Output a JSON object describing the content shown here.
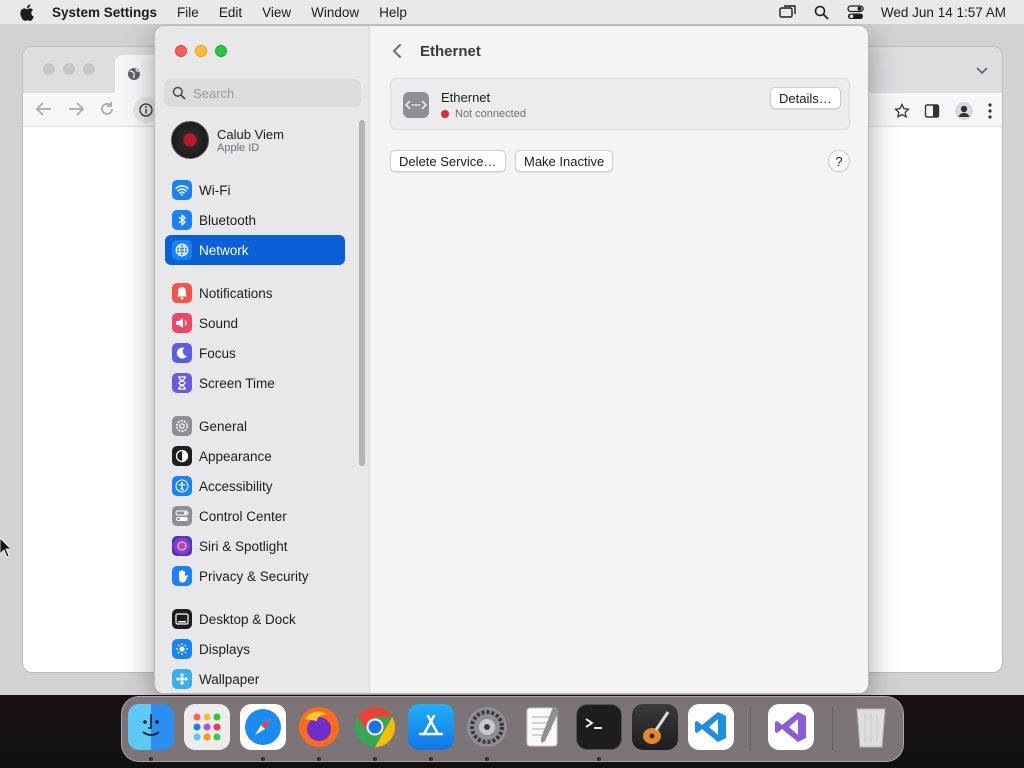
{
  "menubar": {
    "app_name": "System Settings",
    "menus": [
      "File",
      "Edit",
      "View",
      "Window",
      "Help"
    ],
    "clock": "Wed Jun 14  1:57 AM",
    "status_icons": [
      "screen-mirroring-icon",
      "spotlight-search-icon",
      "control-center-icon"
    ]
  },
  "sidebar": {
    "search_placeholder": "Search",
    "account": {
      "name": "Calub Viem",
      "subtitle": "Apple ID"
    },
    "items": [
      {
        "label": "Wi-Fi",
        "icon": "wifi-icon",
        "color": "#1a82f7"
      },
      {
        "label": "Bluetooth",
        "icon": "bluetooth-icon",
        "color": "#1a82f7"
      },
      {
        "label": "Network",
        "icon": "globe-icon",
        "color": "#1a82f7",
        "selected": true
      },
      {
        "label": "Notifications",
        "icon": "bell-icon",
        "color": "#f2534a"
      },
      {
        "label": "Sound",
        "icon": "speaker-icon",
        "color": "#f0466a"
      },
      {
        "label": "Focus",
        "icon": "moon-icon",
        "color": "#5d5ce6"
      },
      {
        "label": "Screen Time",
        "icon": "hourglass-icon",
        "color": "#6a5ae0"
      },
      {
        "label": "General",
        "icon": "gear-icon",
        "color": "#8e8e93"
      },
      {
        "label": "Appearance",
        "icon": "appearance-icon",
        "color": "#1d1d1f"
      },
      {
        "label": "Accessibility",
        "icon": "accessibility-icon",
        "color": "#1a82f7"
      },
      {
        "label": "Control Center",
        "icon": "control-center-icon",
        "color": "#8e8e93"
      },
      {
        "label": "Siri & Spotlight",
        "icon": "siri-icon",
        "color": "#7b3fe4"
      },
      {
        "label": "Privacy & Security",
        "icon": "hand-icon",
        "color": "#1a82f7"
      },
      {
        "label": "Desktop & Dock",
        "icon": "dock-icon",
        "color": "#1d1d1f"
      },
      {
        "label": "Displays",
        "icon": "sun-icon",
        "color": "#1a82f7"
      },
      {
        "label": "Wallpaper",
        "icon": "wallpaper-icon",
        "color": "#3ab0e8"
      }
    ]
  },
  "pane": {
    "title": "Ethernet",
    "service": {
      "name": "Ethernet",
      "status": "Not connected",
      "status_color": "#e02b2b"
    },
    "details_button": "Details…",
    "delete_button": "Delete Service…",
    "inactive_button": "Make Inactive",
    "help_button": "?"
  },
  "dock": {
    "apps": [
      "finder-icon",
      "launchpad-icon",
      "safari-icon",
      "firefox-icon",
      "chrome-icon",
      "app-store-icon",
      "system-settings-icon",
      "textedit-icon",
      "terminal-icon",
      "garageband-icon",
      "vscode-icon",
      "visual-studio-icon",
      "trash-icon"
    ]
  }
}
